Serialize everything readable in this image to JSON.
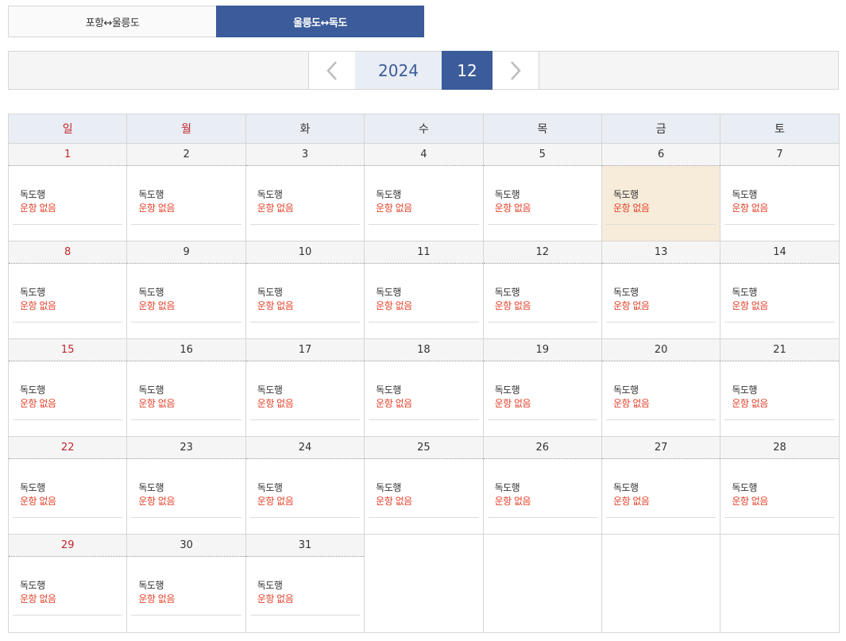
{
  "tabs": [
    {
      "label": "포항↔울릉도",
      "active": false
    },
    {
      "label": "울릉도↔독도",
      "active": true
    }
  ],
  "month_nav": {
    "prev_icon": "chevron-left-icon",
    "next_icon": "chevron-right-icon",
    "year": "2024",
    "month": "12"
  },
  "weekdays": [
    "일",
    "월",
    "화",
    "수",
    "목",
    "금",
    "토"
  ],
  "weeks": [
    [
      "1",
      "2",
      "3",
      "4",
      "5",
      "6",
      "7"
    ],
    [
      "8",
      "9",
      "10",
      "11",
      "12",
      "13",
      "14"
    ],
    [
      "15",
      "16",
      "17",
      "18",
      "19",
      "20",
      "21"
    ],
    [
      "22",
      "23",
      "24",
      "25",
      "26",
      "27",
      "28"
    ],
    [
      "29",
      "30",
      "31",
      "",
      "",
      "",
      ""
    ]
  ],
  "highlighted_day": "6",
  "entry": {
    "destination": "독도행",
    "status": "운항 없음"
  },
  "colors": {
    "accent": "#3b5b9a",
    "sunday": "#c1272d",
    "status": "#e4432b",
    "highlight": "#f7ecda"
  }
}
